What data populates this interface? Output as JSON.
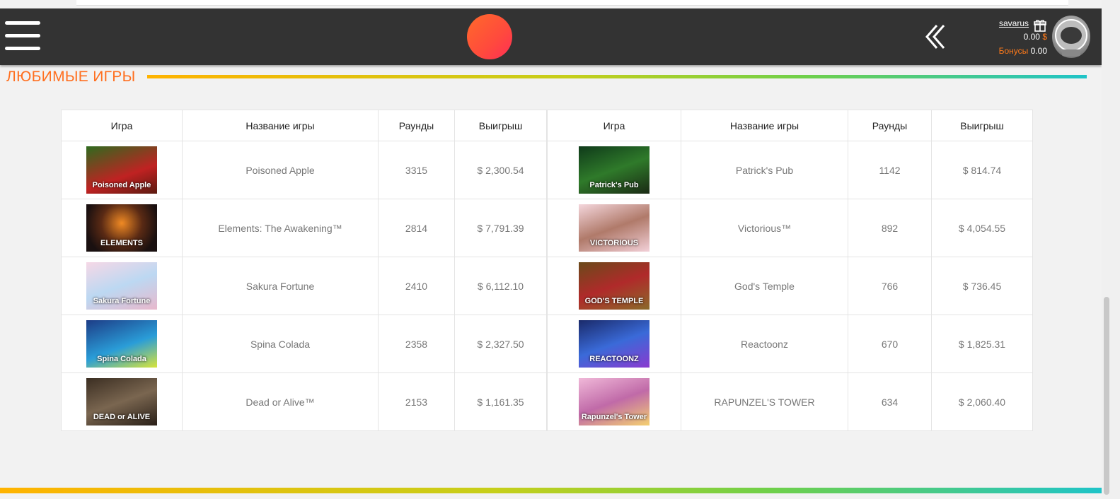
{
  "header": {
    "user": {
      "name": "savarus",
      "balance": "0.00",
      "currency": "$",
      "bonus_label": "Бонусы",
      "bonus_value": "0.00"
    },
    "icons": [
      "menu-icon",
      "logo",
      "chevron-left-icon",
      "gift-icon",
      "avatar"
    ]
  },
  "section": {
    "title": "ЛЮБИМЫЕ ИГРЫ"
  },
  "colors": {
    "header_bg": "#333333",
    "accent": "#ff6f1f"
  },
  "tables": [
    {
      "headers": [
        "Игра",
        "Название игры",
        "Раунды",
        "Выигрыш"
      ],
      "rows": [
        {
          "name": "Poisoned Apple",
          "rounds": "3315",
          "win": "$ 2,300.54",
          "thumb_text": "Poisoned Apple",
          "bg": "linear-gradient(160deg,#2e6b1e,#c02222 60%,#5b1a10)"
        },
        {
          "name": "Elements: The Awakening™",
          "rounds": "2814",
          "win": "$ 7,791.39",
          "thumb_text": "ELEMENTS",
          "bg": "radial-gradient(circle at 50% 40%,#f08a24,#5a2a14 45%,#1a1010 80%)"
        },
        {
          "name": "Sakura Fortune",
          "rounds": "2410",
          "win": "$ 6,112.10",
          "thumb_text": "Sakura Fortune",
          "bg": "linear-gradient(160deg,#f6d8e6,#bcd8f2 50%,#e8b8cc)"
        },
        {
          "name": "Spina Colada",
          "rounds": "2358",
          "win": "$ 2,327.50",
          "thumb_text": "Spina Colada",
          "bg": "linear-gradient(160deg,#1d3c86,#2a9dd8 55%,#d8e43a)"
        },
        {
          "name": "Dead or Alive™",
          "rounds": "2153",
          "win": "$ 1,161.35",
          "thumb_text": "DEAD or ALIVE",
          "bg": "linear-gradient(160deg,#3b2e22,#7a6650 50%,#2a2018)"
        }
      ]
    },
    {
      "headers": [
        "Игра",
        "Название игры",
        "Раунды",
        "Выигрыш"
      ],
      "rows": [
        {
          "name": "Patrick's Pub",
          "rounds": "1142",
          "win": "$ 814.74",
          "thumb_text": "Patrick's Pub",
          "bg": "linear-gradient(160deg,#0f3a1a,#2f7a2a 50%,#1a2a14)"
        },
        {
          "name": "Victorious™",
          "rounds": "892",
          "win": "$ 4,054.55",
          "thumb_text": "VICTORIOUS",
          "bg": "linear-gradient(160deg,#f4d6dc,#b07a6a 50%,#f2d0d8)"
        },
        {
          "name": "God's Temple",
          "rounds": "766",
          "win": "$ 736.45",
          "thumb_text": "GOD'S TEMPLE",
          "bg": "linear-gradient(160deg,#6a4a1a,#b02a2a 50%,#8a6a2a)"
        },
        {
          "name": "Reactoonz",
          "rounds": "670",
          "win": "$ 1,825.31",
          "thumb_text": "REACTOONZ",
          "bg": "linear-gradient(160deg,#1a2a6a,#3a6ad8 50%,#8a3ad0)"
        },
        {
          "name": "RAPUNZEL'S TOWER",
          "rounds": "634",
          "win": "$ 2,060.40",
          "thumb_text": "Rapunzel's Tower",
          "bg": "linear-gradient(160deg,#f0b8d8,#c06aa8 50%,#f4d070)"
        }
      ]
    }
  ]
}
